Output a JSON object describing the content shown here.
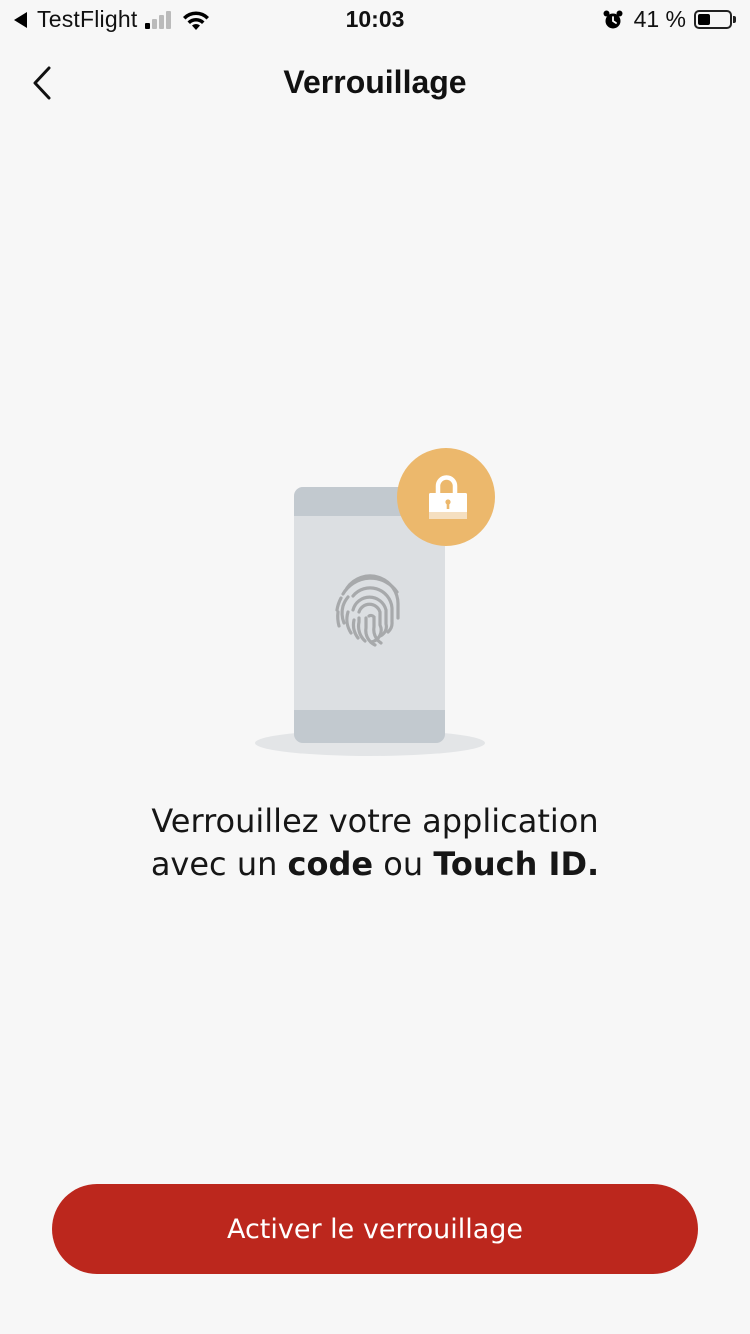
{
  "status_bar": {
    "back_app": "TestFlight",
    "time": "10:03",
    "battery_percent": "41 %",
    "battery_level": 0.41
  },
  "nav": {
    "title": "Verrouillage"
  },
  "content": {
    "line1": "Verrouillez votre application",
    "line2_prefix": "avec un ",
    "line2_bold1": "code",
    "line2_middle": " ou ",
    "line2_bold2": "Touch ID."
  },
  "cta": {
    "label": "Activer le verrouillage"
  },
  "colors": {
    "background": "#f7f7f7",
    "accent": "#bc271d",
    "lock_badge": "#ecb86c",
    "phone_body": "#dcdfe2",
    "phone_bars": "#c2c9cf",
    "fingerprint": "#a7a9ab",
    "shadow": "#e3e5e7"
  },
  "icons": {
    "back": "chevron-left-icon",
    "lock": "padlock-icon",
    "fingerprint": "fingerprint-icon",
    "alarm": "alarm-clock-icon",
    "wifi": "wifi-icon"
  }
}
